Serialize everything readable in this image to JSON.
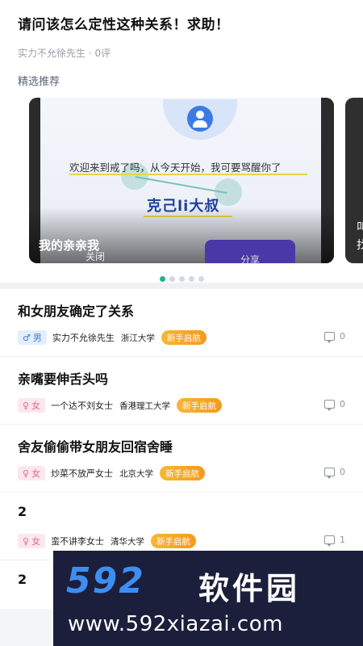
{
  "header": {
    "title": "请问该怎么定性这种关系！求助！",
    "meta": "实力不允徐先生 · 0评"
  },
  "featured": {
    "label": "精选推荐",
    "card": {
      "welcome": "欢迎来到戒了吗，从今天开始，我可要骂醒你了",
      "nickname": "克己li大叔",
      "close_btn": "关闭",
      "share_btn": "分享",
      "caption": "我的亲亲我"
    },
    "next_card": {
      "line1": "叫",
      "line2": "找"
    },
    "carousel_index": 1,
    "carousel_total": 5
  },
  "posts": [
    {
      "title": "和女朋友确定了关系",
      "gender": "男",
      "gender_symbol": "♂",
      "user": "实力不允徐先生",
      "school": "浙江大学",
      "badge": "新手启航",
      "comments": "0"
    },
    {
      "title": "亲嘴要伸舌头吗",
      "gender": "女",
      "gender_symbol": "♀",
      "user": "一个达不刘女士",
      "school": "香港理工大学",
      "badge": "新手启航",
      "comments": "0"
    },
    {
      "title": "舍友偷偷带女朋友回宿舍睡",
      "gender": "女",
      "gender_symbol": "♀",
      "user": "炒菜不放严女士",
      "school": "北京大学",
      "badge": "新手启航",
      "comments": "0"
    },
    {
      "title": "2",
      "gender": "女",
      "gender_symbol": "♀",
      "user": "蛮不讲李女士",
      "school": "清华大学",
      "badge": "新手启航",
      "comments": "1"
    },
    {
      "title": "2"
    }
  ],
  "watermark": {
    "logo": "592",
    "name": "软件园",
    "url": "www.592xiazai.com"
  }
}
